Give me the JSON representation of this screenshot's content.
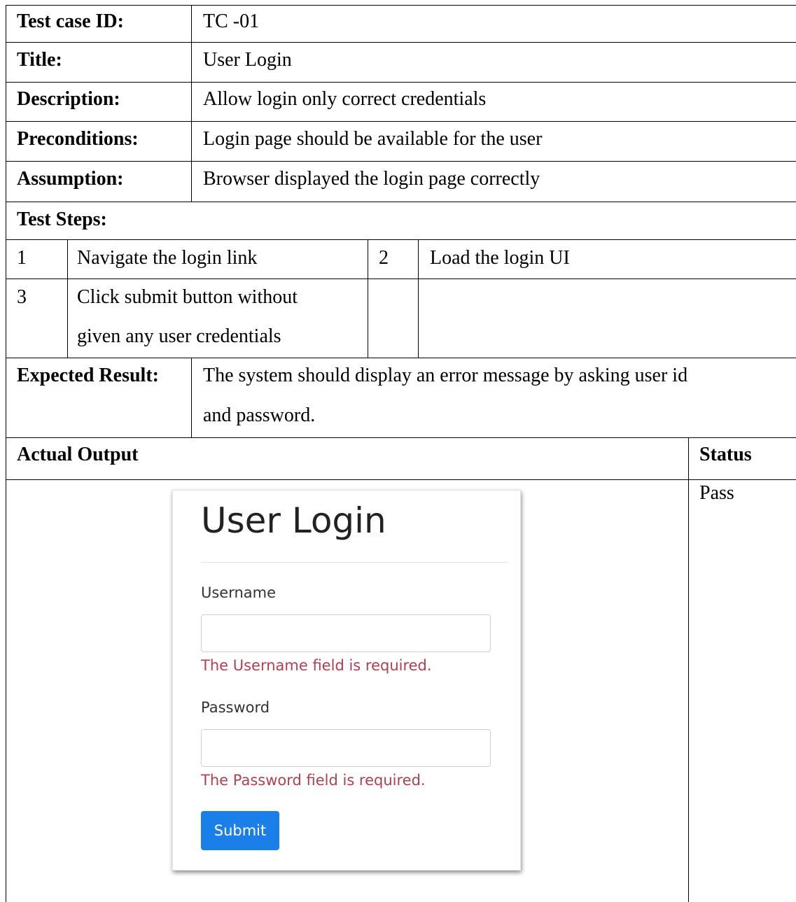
{
  "test_case_id": {
    "label": "Test case ID:",
    "value": "TC -01"
  },
  "title": {
    "label": "Title:",
    "value": "User Login"
  },
  "description": {
    "label": "Description:",
    "value": "Allow login only correct credentials"
  },
  "preconditions": {
    "label": "Preconditions:",
    "value": "Login page should be available for the user"
  },
  "assumption": {
    "label": "Assumption:",
    "value": "Browser displayed the login page correctly"
  },
  "test_steps": {
    "label": "Test Steps:",
    "steps": [
      {
        "number": "1",
        "text": "Navigate the login link"
      },
      {
        "number": "2",
        "text": "Load the login UI"
      },
      {
        "number": "3",
        "lines": [
          "Click submit button without",
          "given any user credentials"
        ]
      }
    ]
  },
  "expected_result": {
    "label": "Expected Result:",
    "lines": [
      "The system should display an error message by asking user id",
      "and password."
    ]
  },
  "actual_output": {
    "label": "Actual Output"
  },
  "status": {
    "label": "Status",
    "value": "Pass"
  },
  "login_screenshot": {
    "title": "User Login",
    "username_label": "Username",
    "username_error": "The Username field is required.",
    "password_label": "Password",
    "password_error": "The Password field is required.",
    "submit_label": "Submit",
    "colors": {
      "error": "#b04050",
      "button": "#1a7fe8"
    }
  }
}
